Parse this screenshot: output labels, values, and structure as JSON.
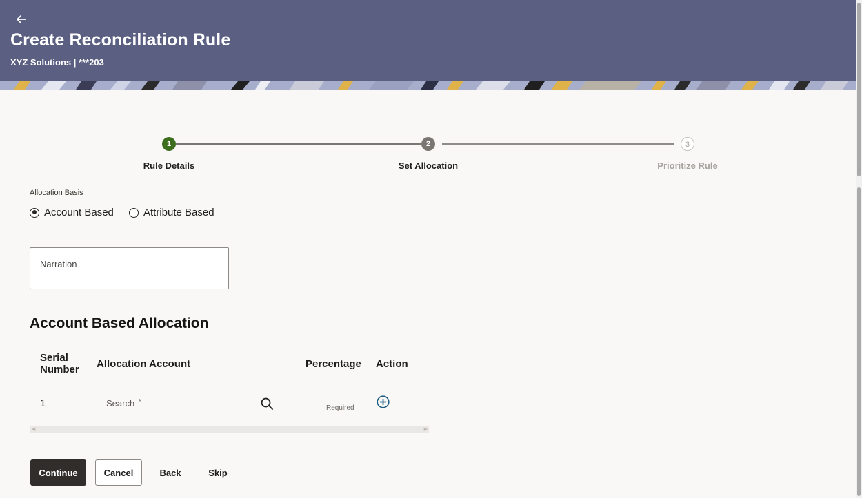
{
  "header": {
    "title": "Create Reconciliation Rule",
    "subtitle": "XYZ Solutions | ***203"
  },
  "stepper": {
    "steps": [
      {
        "number": "1",
        "label": "Rule Details",
        "state": "completed",
        "color": "#3c6e1e"
      },
      {
        "number": "2",
        "label": "Set Allocation",
        "state": "current",
        "color": "#7a7672"
      },
      {
        "number": "3",
        "label": "Prioritize Rule",
        "state": "upcoming",
        "color": "#b9b6b2"
      }
    ]
  },
  "allocation_basis": {
    "label": "Allocation Basis",
    "options": [
      {
        "label": "Account Based",
        "selected": true
      },
      {
        "label": "Attribute Based",
        "selected": false
      }
    ]
  },
  "narration": {
    "label": "Narration",
    "value": ""
  },
  "allocation_section": {
    "title": "Account Based Allocation",
    "columns": {
      "serial_line1": "Serial",
      "serial_line2": "Number",
      "account": "Allocation Account",
      "percentage": "Percentage",
      "action": "Action"
    },
    "rows": [
      {
        "serial": "1",
        "account_placeholder": "Search",
        "required_marker": "*",
        "percentage_hint": "Required"
      }
    ]
  },
  "buttons": {
    "continue": "Continue",
    "cancel": "Cancel",
    "back": "Back",
    "skip": "Skip"
  },
  "colors": {
    "header_bg": "#5b5f82",
    "primary_button": "#312d2a",
    "add_icon": "#1f5f86"
  },
  "icons": [
    "back-arrow-icon",
    "search-icon",
    "add-circle-icon"
  ]
}
